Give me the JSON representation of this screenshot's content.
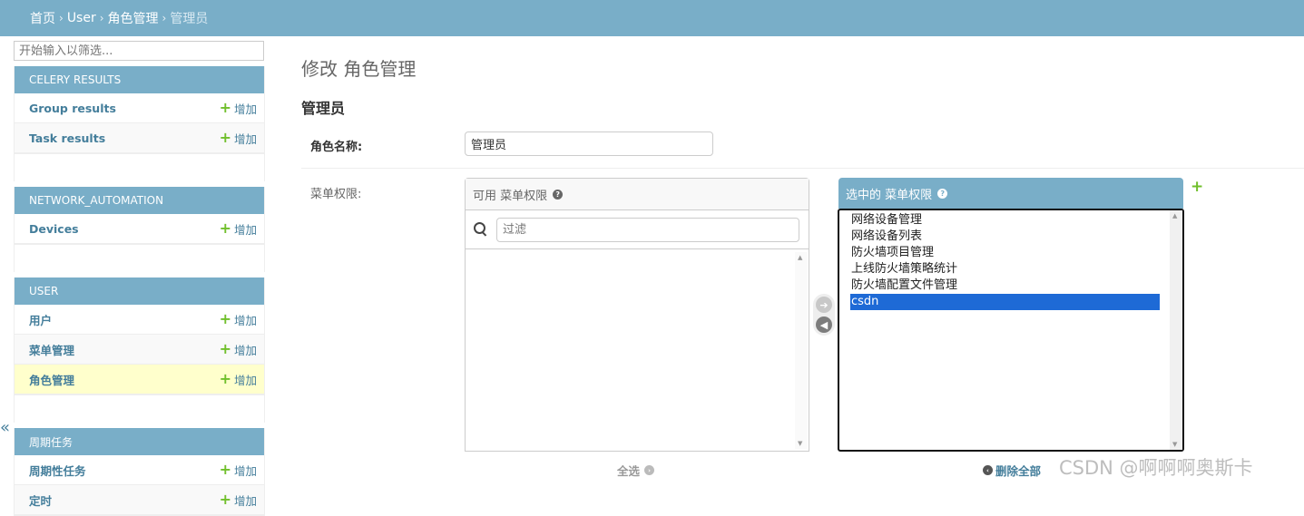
{
  "breadcrumbs": {
    "home": "首页",
    "app": "User",
    "model": "角色管理",
    "current": "管理员"
  },
  "sidebar": {
    "filter_placeholder": "开始输入以筛选...",
    "add_label": "增加",
    "modules": [
      {
        "caption": "CELERY RESULTS",
        "models": [
          "Group results",
          "Task results"
        ]
      },
      {
        "caption": "NETWORK_AUTOMATION",
        "models": [
          "Devices"
        ]
      },
      {
        "caption": "USER",
        "models": [
          "用户",
          "菜单管理",
          "角色管理"
        ],
        "active": "角色管理"
      },
      {
        "caption": "周期任务",
        "models": [
          "周期性任务",
          "定时"
        ]
      }
    ],
    "collapse_glyph": "«"
  },
  "form": {
    "title": "修改 角色管理",
    "object_name": "管理员",
    "name_label": "角色名称:",
    "name_value": "管理员",
    "perm_label": "菜单权限:"
  },
  "selector": {
    "available_title": "可用 菜单权限",
    "filter_placeholder": "过滤",
    "chosen_title": "选中的 菜单权限",
    "chosen_items": [
      "网络设备管理",
      "网络设备列表",
      "防火墙项目管理",
      "上线防火墙策略统计",
      "防火墙配置文件管理",
      "csdn"
    ],
    "selected_item": "csdn",
    "choose_all": "全选",
    "remove_all": "删除全部"
  },
  "watermark": "CSDN @啊啊啊奥斯卡",
  "colors": {
    "header": "#79aec8",
    "link": "#447e9b",
    "add": "#70bf2b",
    "selected": "#1e6ad6",
    "active_row": "#ffffcc"
  }
}
